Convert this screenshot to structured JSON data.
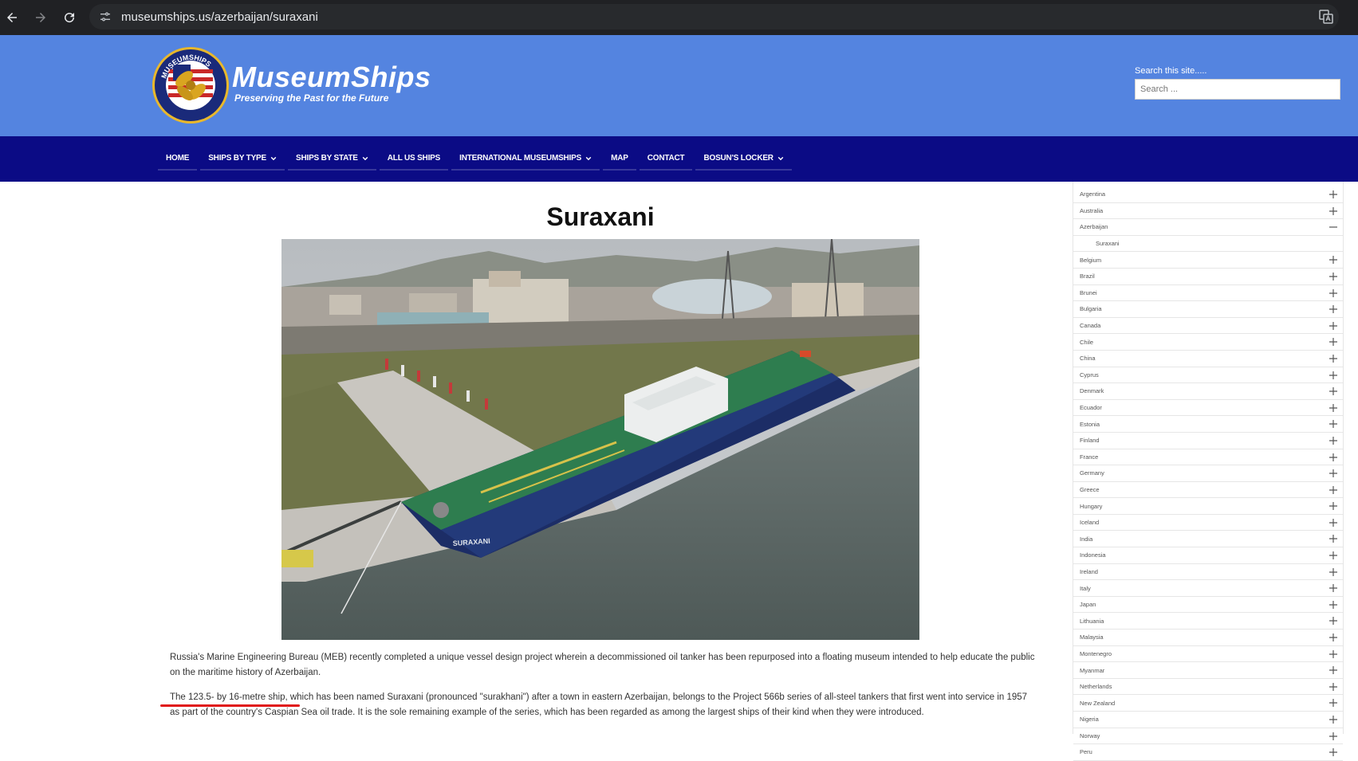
{
  "browser": {
    "url": "museumships.us/azerbaijan/suraxani",
    "icons": [
      "back-arrow-icon",
      "forward-arrow-icon",
      "reload-icon",
      "site-info-icon",
      "translate-icon"
    ]
  },
  "header": {
    "site_title": "MuseumShips",
    "tagline": "Preserving the Past for the Future",
    "logo_ring_text": "MUSEUMSHIPS",
    "search_label": "Search this site.....",
    "search_placeholder": "Search ...",
    "brand_color": "#5484e0"
  },
  "nav": {
    "bg_color": "#0b0b85",
    "items": [
      {
        "label": "HOME",
        "has_dropdown": false
      },
      {
        "label": "SHIPS BY TYPE",
        "has_dropdown": true
      },
      {
        "label": "SHIPS BY STATE",
        "has_dropdown": true
      },
      {
        "label": "ALL US SHIPS",
        "has_dropdown": false
      },
      {
        "label": "INTERNATIONAL MUSEUMSHIPS",
        "has_dropdown": true
      },
      {
        "label": "MAP",
        "has_dropdown": false
      },
      {
        "label": "CONTACT",
        "has_dropdown": false
      },
      {
        "label": "BOSUN'S LOCKER",
        "has_dropdown": true
      }
    ]
  },
  "main": {
    "title": "Suraxani",
    "photo_caption_text": "SURAXANI",
    "paragraphs": [
      "Russia's Marine Engineering Bureau (MEB) recently completed a unique vessel design project wherein a decommissioned oil tanker has been repurposed into a floating museum intended to help educate the public on the maritime history of Azerbaijan.",
      "The 123.5- by 16-metre ship, which has been named Suraxani (pronounced \"surakhani\") after a town in eastern Azerbaijan, belongs to the Project 566b series of all-steel tankers that first went into service in 1957 as part of the country's Caspian Sea oil trade. It is the sole remaining example of the series, which has been regarded as among the largest ships of their kind when they were introduced."
    ],
    "highlight_color": "#e01515"
  },
  "sidebar": {
    "items": [
      {
        "label": "Argentina",
        "state": "collapsed"
      },
      {
        "label": "Australia",
        "state": "collapsed"
      },
      {
        "label": "Azerbaijan",
        "state": "expanded"
      },
      {
        "label": "Suraxani",
        "state": "child"
      },
      {
        "label": "Belgium",
        "state": "collapsed"
      },
      {
        "label": "Brazil",
        "state": "collapsed"
      },
      {
        "label": "Brunei",
        "state": "collapsed"
      },
      {
        "label": "Bulgaria",
        "state": "collapsed"
      },
      {
        "label": "Canada",
        "state": "collapsed"
      },
      {
        "label": "Chile",
        "state": "collapsed"
      },
      {
        "label": "China",
        "state": "collapsed"
      },
      {
        "label": "Cyprus",
        "state": "collapsed"
      },
      {
        "label": "Denmark",
        "state": "collapsed"
      },
      {
        "label": "Ecuador",
        "state": "collapsed"
      },
      {
        "label": "Estonia",
        "state": "collapsed"
      },
      {
        "label": "Finland",
        "state": "collapsed"
      },
      {
        "label": "France",
        "state": "collapsed"
      },
      {
        "label": "Germany",
        "state": "collapsed"
      },
      {
        "label": "Greece",
        "state": "collapsed"
      },
      {
        "label": "Hungary",
        "state": "collapsed"
      },
      {
        "label": "Iceland",
        "state": "collapsed"
      },
      {
        "label": "India",
        "state": "collapsed"
      },
      {
        "label": "Indonesia",
        "state": "collapsed"
      },
      {
        "label": "Ireland",
        "state": "collapsed"
      },
      {
        "label": "Italy",
        "state": "collapsed"
      },
      {
        "label": "Japan",
        "state": "collapsed"
      },
      {
        "label": "Lithuania",
        "state": "collapsed"
      },
      {
        "label": "Malaysia",
        "state": "collapsed"
      },
      {
        "label": "Montenegro",
        "state": "collapsed"
      },
      {
        "label": "Myanmar",
        "state": "collapsed"
      },
      {
        "label": "Netherlands",
        "state": "collapsed"
      },
      {
        "label": "New Zealand",
        "state": "collapsed"
      },
      {
        "label": "Nigeria",
        "state": "collapsed"
      },
      {
        "label": "Norway",
        "state": "collapsed"
      },
      {
        "label": "Peru",
        "state": "collapsed"
      }
    ]
  }
}
